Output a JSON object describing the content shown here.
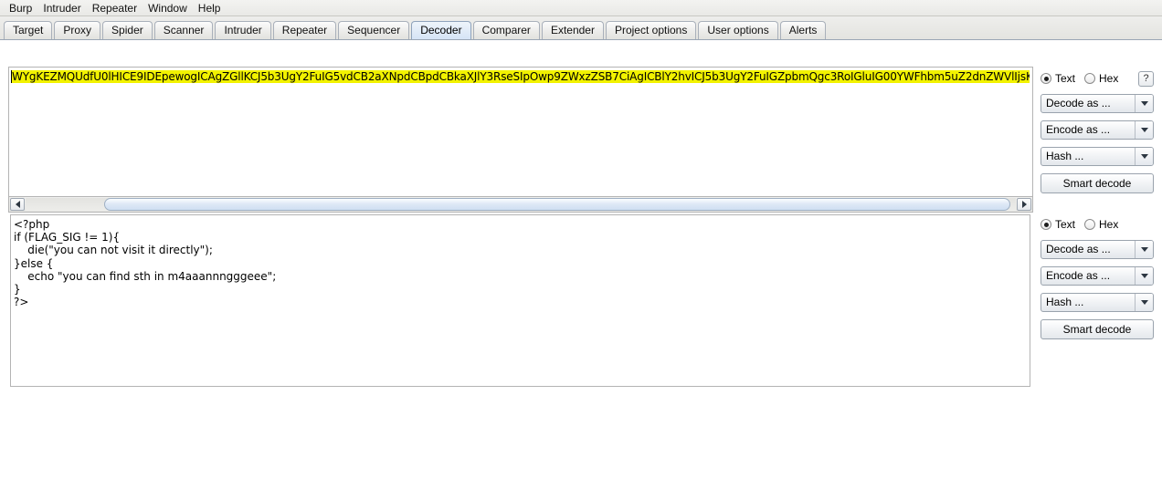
{
  "menubar": {
    "items": [
      {
        "label": "Burp"
      },
      {
        "label": "Intruder"
      },
      {
        "label": "Repeater"
      },
      {
        "label": "Window"
      },
      {
        "label": "Help"
      }
    ]
  },
  "tabs": {
    "items": [
      {
        "label": "Target",
        "selected": false
      },
      {
        "label": "Proxy",
        "selected": false
      },
      {
        "label": "Spider",
        "selected": false
      },
      {
        "label": "Scanner",
        "selected": false
      },
      {
        "label": "Intruder",
        "selected": false
      },
      {
        "label": "Repeater",
        "selected": false
      },
      {
        "label": "Sequencer",
        "selected": false
      },
      {
        "label": "Decoder",
        "selected": true
      },
      {
        "label": "Comparer",
        "selected": false
      },
      {
        "label": "Extender",
        "selected": false
      },
      {
        "label": "Project options",
        "selected": false
      },
      {
        "label": "User options",
        "selected": false
      },
      {
        "label": "Alerts",
        "selected": false
      }
    ]
  },
  "decoder": {
    "input_panel": {
      "text": "WYgKEZMQUdfU0lHICE9IDEpewogICAgZGllKCJ5b3UgY2FuIG5vdCB2aXNpdCBpdCBkaXJlY3RseSIpOwp9ZWxzZSB7CiAgICBlY2hvICJ5b3UgY2FuIGZpbmQgc3RoIGluIG00YWFhbm5uZ2dnZWVlIjsKfQo/Pg==",
      "highlight_color": "#f2f200"
    },
    "output_panel": {
      "text": "<?php\nif (FLAG_SIG != 1){\n    die(\"you can not visit it directly\");\n}else {\n    echo \"you can find sth in m4aaannngggeee\";\n}\n?>"
    },
    "controls_top": {
      "text_radio_label": "Text",
      "hex_radio_label": "Hex",
      "selected_mode": "Text",
      "help_label": "?",
      "decode_as_label": "Decode as ...",
      "encode_as_label": "Encode as ...",
      "hash_label": "Hash ...",
      "smart_decode_label": "Smart decode"
    },
    "controls_bottom": {
      "text_radio_label": "Text",
      "hex_radio_label": "Hex",
      "selected_mode": "Text",
      "decode_as_label": "Decode as ...",
      "encode_as_label": "Encode as ...",
      "hash_label": "Hash ...",
      "smart_decode_label": "Smart decode"
    }
  }
}
